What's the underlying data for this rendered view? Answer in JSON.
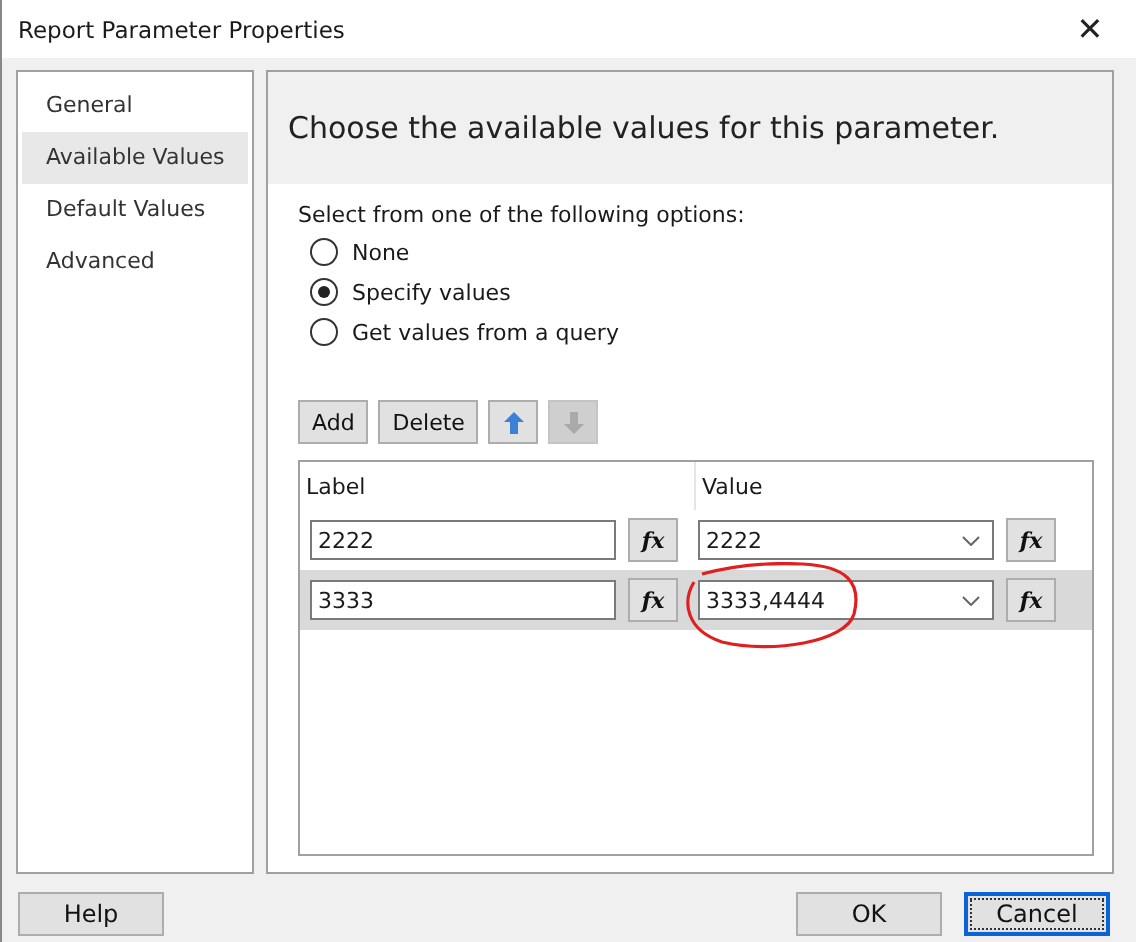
{
  "window": {
    "title": "Report Parameter Properties",
    "close": "✕"
  },
  "sidebar": {
    "items": [
      {
        "label": "General",
        "selected": false
      },
      {
        "label": "Available Values",
        "selected": true
      },
      {
        "label": "Default Values",
        "selected": false
      },
      {
        "label": "Advanced",
        "selected": false
      }
    ]
  },
  "header": "Choose the available values for this parameter.",
  "options_label": "Select from one of the following options:",
  "options": [
    {
      "label": "None",
      "selected": false
    },
    {
      "label": "Specify values",
      "selected": true
    },
    {
      "label": "Get values from a query",
      "selected": false
    }
  ],
  "toolbar": {
    "add": "Add",
    "delete": "Delete",
    "move_up_disabled": false,
    "move_down_disabled": true
  },
  "table": {
    "columns": [
      "Label",
      "Value"
    ],
    "rows": [
      {
        "label": "2222",
        "label_fx": "fx",
        "value": "2222",
        "value_fx": "fx",
        "selected": false,
        "annotated": false
      },
      {
        "label": "3333",
        "label_fx": "fx",
        "value": "3333,4444",
        "value_fx": "fx",
        "selected": true,
        "annotated": true
      }
    ]
  },
  "footer": {
    "help": "Help",
    "ok": "OK",
    "cancel": "Cancel"
  }
}
